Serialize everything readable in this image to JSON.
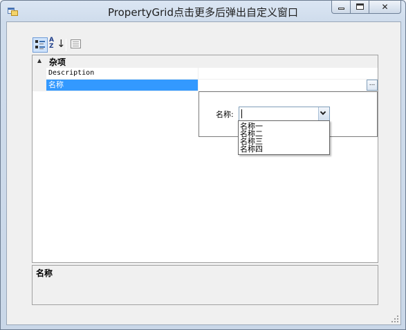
{
  "window": {
    "title": "PropertyGrid点击更多后弹出自定义窗口",
    "minimize_icon": "minimize-icon",
    "maximize_icon": "maximize-icon",
    "close_glyph": "✕"
  },
  "toolbar": {
    "buttons": [
      {
        "icon": "categorized-icon",
        "active": true
      },
      {
        "icon": "alphabetical-sort-icon",
        "active": false,
        "text": "A Z"
      },
      {
        "icon": "property-pages-icon",
        "active": false
      }
    ]
  },
  "grid": {
    "category": "杂项",
    "properties": [
      {
        "name": "Description",
        "value": ""
      },
      {
        "name": "名称",
        "value": "",
        "selected": true
      }
    ],
    "ellipsis_label": "..."
  },
  "popup": {
    "label": "名称:",
    "combo_value": "",
    "options": [
      "名称一",
      "名称二",
      "名称三",
      "名称四"
    ]
  },
  "help": {
    "title": "名称"
  },
  "colors": {
    "selection": "#3399ff",
    "frame": "#c9d7e8"
  },
  "backdrop": {
    "gutter": [
      "1",
      "1",
      "1",
      "1",
      "1",
      "1",
      "1",
      "1",
      "1",
      "1",
      "1",
      "1",
      "2",
      "2"
    ]
  }
}
